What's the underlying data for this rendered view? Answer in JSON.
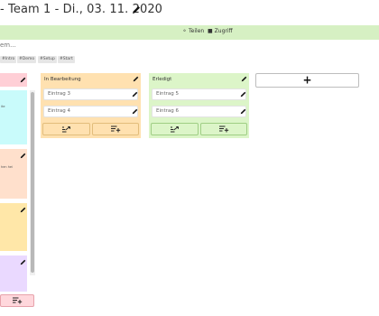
{
  "header": {
    "title": "- Team 1 - Di., 03. 11. 2020",
    "edit_icon": "pencil-icon"
  },
  "toolbar": {
    "links": [
      {
        "label": "Teilen",
        "icon": "share-icon"
      },
      {
        "label": "Zugriff",
        "icon": "lock-icon"
      }
    ]
  },
  "filter": {
    "placeholder": "em..."
  },
  "tags": [
    "#Intro",
    "#Demo",
    "#Setup",
    "#Start"
  ],
  "columns": [
    {
      "title": "In Bearbeitung",
      "color": "#ffe1b0",
      "entries": [
        "Eintrag 3",
        "Eintrag 4"
      ],
      "action_colors": {
        "bg": "#ffe1b0",
        "border": "#e2bd7b"
      }
    },
    {
      "title": "Erledigt",
      "color": "#dcf5c8",
      "entries": [
        "Eintrag 5",
        "Eintrag 6"
      ],
      "action_colors": {
        "bg": "#dcf5c8",
        "border": "#9fce84"
      }
    }
  ],
  "add_column": {
    "label": "+"
  },
  "left_column": {
    "header_color": "#ffcfd6",
    "cards": [
      {
        "color": "#c9fbfb",
        "text": "ite"
      },
      {
        "color": "#ffe0cc",
        "text": "hen hei"
      },
      {
        "color": "#ffe7a8",
        "text": ""
      },
      {
        "color": "#ead9ff",
        "text": ""
      }
    ],
    "footer_action_colors": {
      "bg": "#ffd7dc",
      "border": "#e7a2ab"
    }
  }
}
